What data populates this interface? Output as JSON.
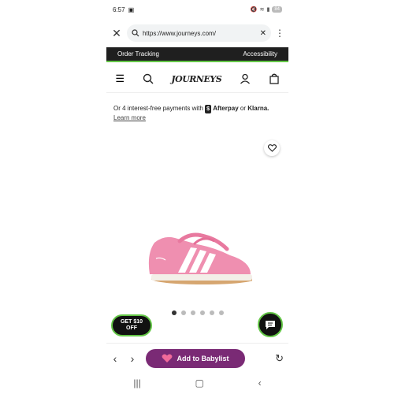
{
  "status_bar": {
    "time": "6:57",
    "battery": "84"
  },
  "browser": {
    "url": "https://www.journeys.com/"
  },
  "promo_bar": {
    "left_link": "Order Tracking",
    "right_link": "Accessibility"
  },
  "header": {
    "logo_text": "JOURNEYS"
  },
  "payment": {
    "text_prefix": "Or 4 interest-free payments with",
    "afterpay_label": "Afterpay",
    "or_text": "or",
    "klarna_label": "Klarna.",
    "learn_more": "Learn more"
  },
  "carousel": {
    "dot_count": 6,
    "active_index": 0
  },
  "promo_button": {
    "line1": "GET $10",
    "line2": "OFF"
  },
  "toolbar": {
    "babylist_label": "Add to Babylist"
  },
  "colors": {
    "accent_green": "#63c646",
    "babylist_purple": "#7a2a75",
    "shoe_pink": "#ef8fb0"
  }
}
